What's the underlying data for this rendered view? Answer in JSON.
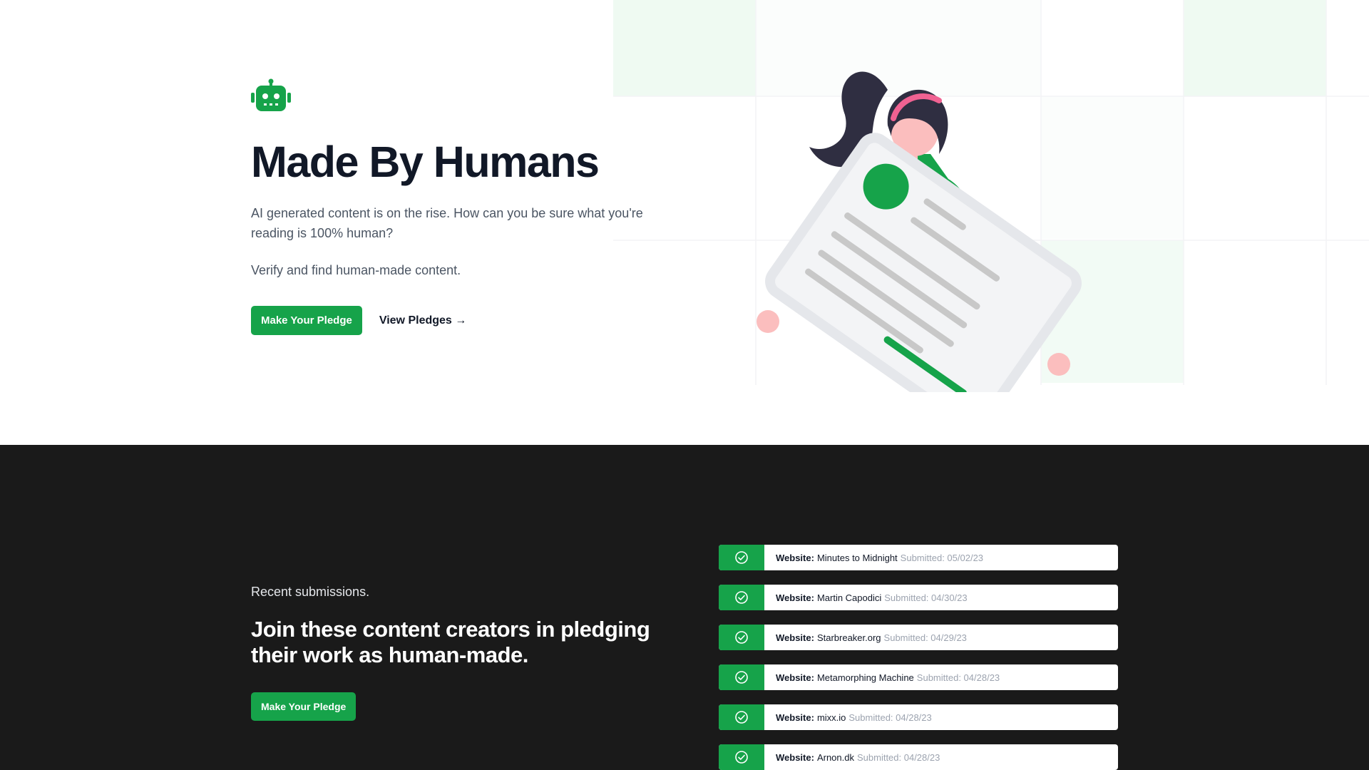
{
  "hero": {
    "title": "Made By Humans",
    "description": "AI generated content is on the rise. How can you be sure what you're reading is 100% human?",
    "subtext": "Verify and find human-made content.",
    "primary_button": "Make Your Pledge",
    "secondary_link": "View Pledges →"
  },
  "recent": {
    "eyebrow": "Recent submissions.",
    "title": "Join these content creators in pledging their work as human-made.",
    "button": "Make Your Pledge",
    "website_label": "Website:",
    "submissions": [
      {
        "name": "Minutes to Midnight",
        "submitted": "Submitted: 05/02/23"
      },
      {
        "name": "Martin Capodici",
        "submitted": "Submitted: 04/30/23"
      },
      {
        "name": "Starbreaker.org",
        "submitted": "Submitted: 04/29/23"
      },
      {
        "name": "Metamorphing Machine",
        "submitted": "Submitted: 04/28/23"
      },
      {
        "name": "mixx.io",
        "submitted": "Submitted: 04/28/23"
      },
      {
        "name": "Arnon.dk",
        "submitted": "Submitted: 04/28/23"
      }
    ]
  },
  "colors": {
    "accent": "#16a34a",
    "dark_bg": "#1a1a1a",
    "heading": "#111827"
  },
  "icons": {
    "logo": "robot-icon",
    "submission": "check-circle-icon"
  }
}
